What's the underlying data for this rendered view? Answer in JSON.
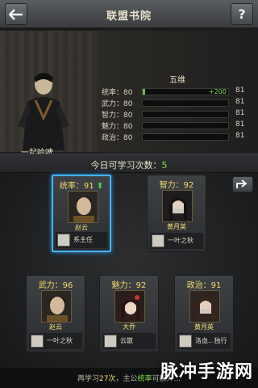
{
  "header": {
    "title": "联盟书院",
    "help_label": "?"
  },
  "hero": {
    "name": "一起哈啤",
    "stats_title": "五维",
    "stats": [
      {
        "label": "统率：80",
        "fill": 0.03,
        "gain": "+200",
        "max": "81"
      },
      {
        "label": "武力：80",
        "fill": 0.0,
        "gain": "",
        "max": "81"
      },
      {
        "label": "智力：80",
        "fill": 0.0,
        "gain": "",
        "max": "81"
      },
      {
        "label": "魅力：80",
        "fill": 0.0,
        "gain": "",
        "max": "81"
      },
      {
        "label": "政治：80",
        "fill": 0.0,
        "gain": "",
        "max": "81"
      }
    ]
  },
  "study": {
    "prefix": "今日可学习次数：",
    "count": "5"
  },
  "cards": [
    {
      "attr": "统率：91",
      "up_arrow": true,
      "name": "赵云",
      "mentor": "系主任",
      "selected": true
    },
    {
      "attr": "智力：92",
      "up_arrow": false,
      "name": "黄月英",
      "mentor": "一叶之秋",
      "selected": false
    },
    {
      "attr": "武力：96",
      "up_arrow": false,
      "name": "赵云",
      "mentor": "一叶之秋",
      "selected": false
    },
    {
      "attr": "魅力：92",
      "up_arrow": false,
      "name": "大乔",
      "mentor": "云散",
      "selected": false
    },
    {
      "attr": "政治：91",
      "up_arrow": false,
      "name": "黄月英",
      "mentor": "洛血...独行",
      "selected": false
    }
  ],
  "footer": {
    "p1": "再学习",
    "count": "27次",
    "p2": "，主公",
    "attr": "统率",
    "p3": "可额外..."
  },
  "watermark": "脉冲手游网",
  "colors": {
    "accent_green": "#7fe04a",
    "select_blue": "#46b5ff",
    "gold": "#f2d86a"
  }
}
